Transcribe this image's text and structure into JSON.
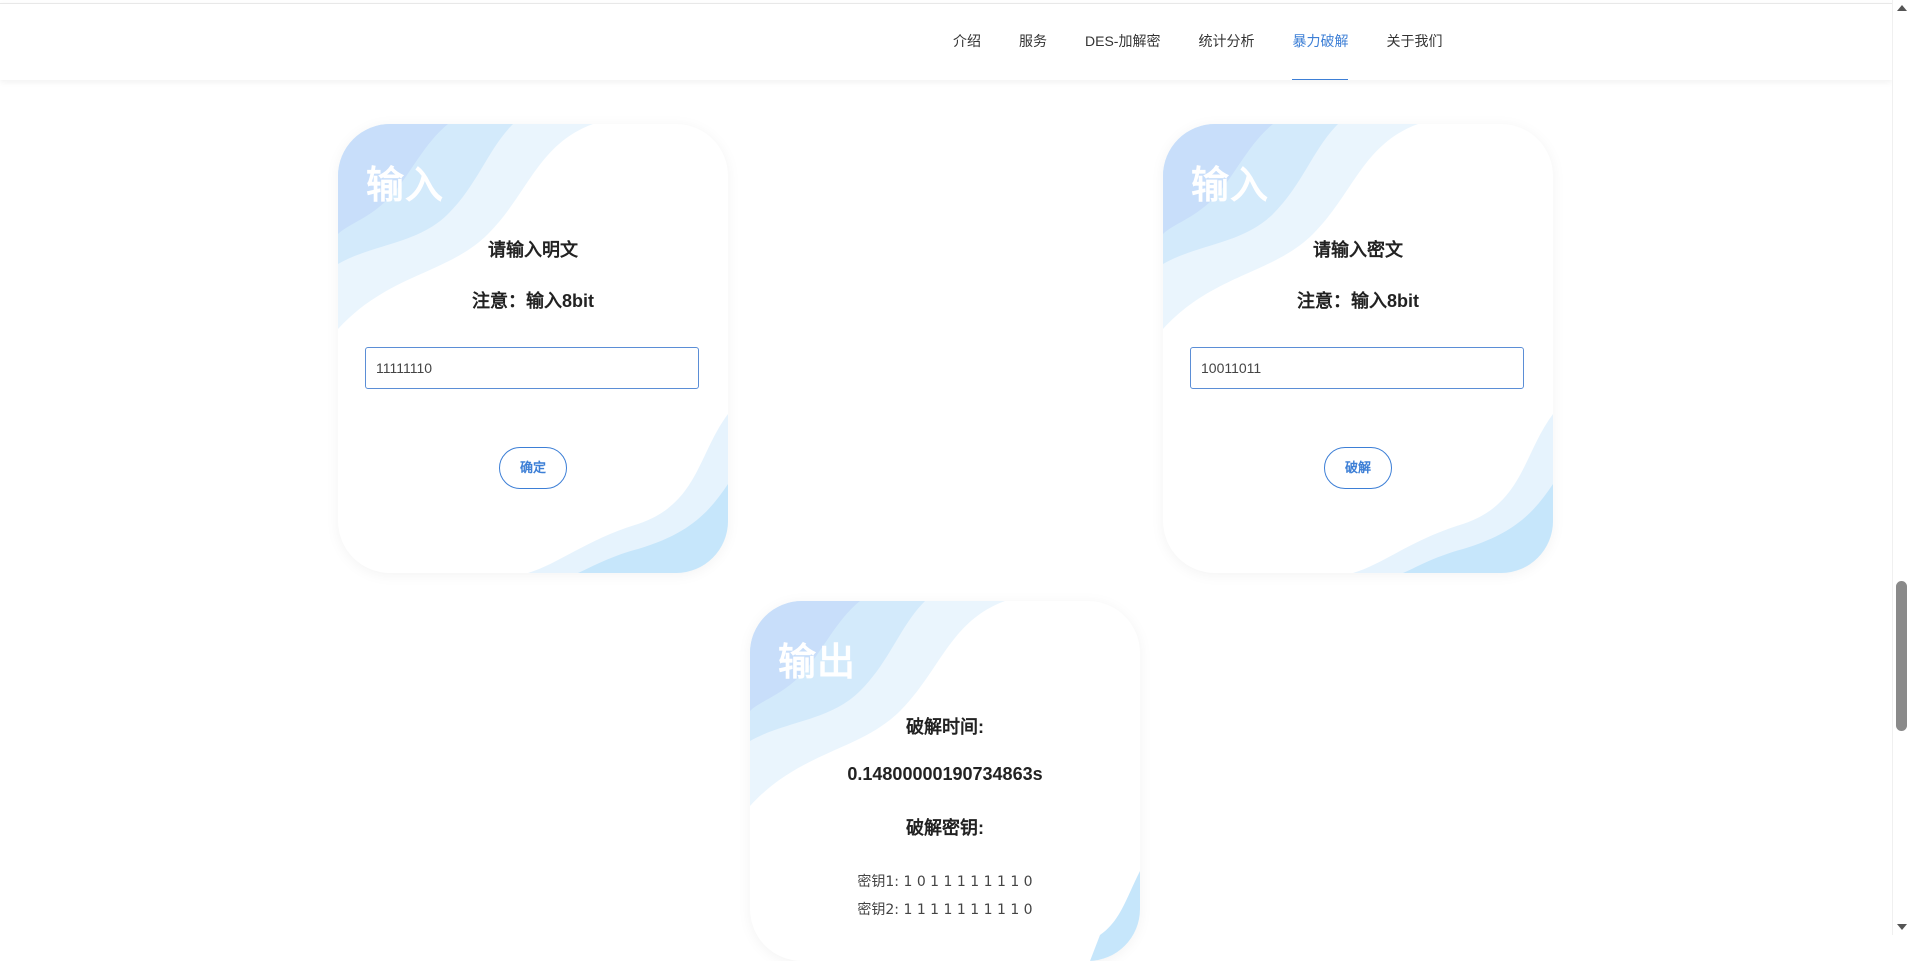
{
  "nav": {
    "items": [
      {
        "label": "介绍"
      },
      {
        "label": "服务"
      },
      {
        "label": "DES-加解密"
      },
      {
        "label": "统计分析"
      },
      {
        "label": "暴力破解",
        "active": true
      },
      {
        "label": "关于我们"
      }
    ]
  },
  "encrypt_card": {
    "title": "输入",
    "heading": "请输入明文",
    "note": "注意：输入8bit",
    "input_value": "11111110",
    "button_label": "确定"
  },
  "crack_card": {
    "title": "输入",
    "heading": "请输入密文",
    "note": "注意：输入8bit",
    "input_value": "10011011",
    "button_label": "破解"
  },
  "output_card": {
    "title": "输出",
    "time_label": "破解时间:",
    "time_value": "0.14800000190734863s",
    "key_label": "破解密钥:",
    "keys": [
      "密钥1: 1 0 1 1 1 1 1 1 1 0",
      "密钥2: 1 1 1 1 1 1 1 1 1 0"
    ]
  },
  "colors": {
    "accent": "#3d7fd6",
    "wave_light": "#e6f3fd",
    "wave_mid": "#cfe8fb",
    "wave_dark": "#b7dcf9"
  }
}
